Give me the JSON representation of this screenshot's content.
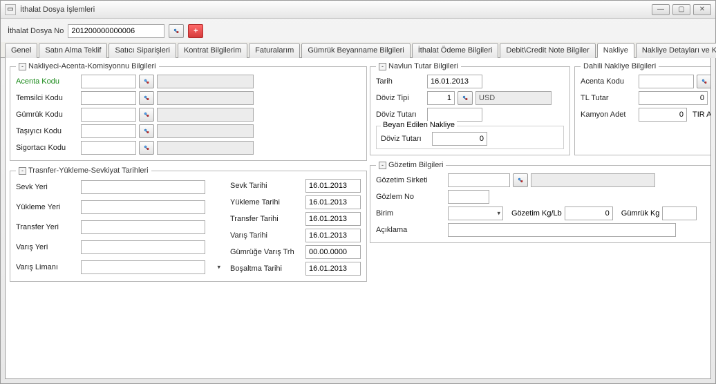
{
  "window": {
    "title": "İthalat Dosya İşlemleri"
  },
  "toolbar": {
    "dosyaNoLabel": "İthalat Dosya No",
    "dosyaNoValue": "201200000000006"
  },
  "tabs": [
    {
      "label": "Genel"
    },
    {
      "label": "Satın Alma Teklif"
    },
    {
      "label": "Satıcı Siparişleri"
    },
    {
      "label": "Kontrat Bilgilerim"
    },
    {
      "label": "Faturalarım"
    },
    {
      "label": "Gümrük Beyanname Bilgileri"
    },
    {
      "label": "İthalat Ödeme Bilgileri"
    },
    {
      "label": "Debit\\Credit Note Bilgiler"
    },
    {
      "label": "Nakliye"
    },
    {
      "label": "Nakliye Detayları ve Konsimento Bilgileri"
    }
  ],
  "activeTabIndex": 8,
  "groups": {
    "nakliyeci": {
      "legend": "Nakliyeci-Acenta-Komisyonnu Bilgileri",
      "rows": [
        {
          "label": "Acenta Kodu",
          "green": true
        },
        {
          "label": "Temsilci Kodu"
        },
        {
          "label": "Gümrük Kodu"
        },
        {
          "label": "Taşıyıcı Kodu"
        },
        {
          "label": "Sigortacı Kodu"
        }
      ]
    },
    "transfer": {
      "legend": "Trasnfer-Yükleme-Sevkiyat Tarihleri",
      "left": [
        {
          "label": "Sevk Yeri",
          "value": ""
        },
        {
          "label": "Yükleme Yeri",
          "value": ""
        },
        {
          "label": "Transfer Yeri",
          "value": ""
        },
        {
          "label": "Varış Yeri",
          "value": ""
        },
        {
          "label": "Varış Limanı",
          "value": "",
          "combo": true
        }
      ],
      "right": [
        {
          "label": "Sevk Tarihi",
          "value": "16.01.2013"
        },
        {
          "label": "Yükleme Tarihi",
          "value": "16.01.2013"
        },
        {
          "label": "Transfer Tarihi",
          "value": "16.01.2013"
        },
        {
          "label": "Varış Tarihi",
          "value": "16.01.2013"
        },
        {
          "label": "Gümrüğe Varış Trh",
          "value": "00.00.0000"
        },
        {
          "label": "Boşaltma Tarihi",
          "value": "16.01.2013"
        }
      ]
    },
    "navlun": {
      "legend": "Navlun Tutar Bilgileri",
      "tarihLabel": "Tarih",
      "tarihValue": "16.01.2013",
      "dovizTipiLabel": "Döviz Tipi",
      "dovizTipiValue": "1",
      "dovizTipiName": "USD",
      "dovizTutariLabel": "Döviz Tutarı",
      "dovizTutariValue": "",
      "beyanBox": {
        "legend": "Beyan Edilen Nakliye",
        "dovizTutariLabel": "Döviz Tutarı",
        "dovizTutariValue": "0"
      }
    },
    "dahili": {
      "legend": "Dahili Nakliye Bilgileri",
      "acentaKoduLabel": "Acenta Kodu",
      "acentaKoduValue": "",
      "tlTutarLabel": "TL Tutar",
      "tlTutarValue": "0",
      "kamyonAdetLabel": "Kamyon Adet",
      "kamyonAdetValue": "0",
      "tirLabel": "TIR A"
    },
    "gozetim": {
      "legend": "Gözetim Bilgileri",
      "sirketLabel": "Gözetim Sirketi",
      "gozlemNoLabel": "Gözlem No",
      "birimLabel": "Birim",
      "gozetimKgLabel": "Gözetim  Kg/Lb",
      "gozetimKgValue": "0",
      "gumrukKgLabel": "Gümrük Kg",
      "gumrukKgValue": "",
      "aciklamaLabel": "Açıklama"
    }
  }
}
